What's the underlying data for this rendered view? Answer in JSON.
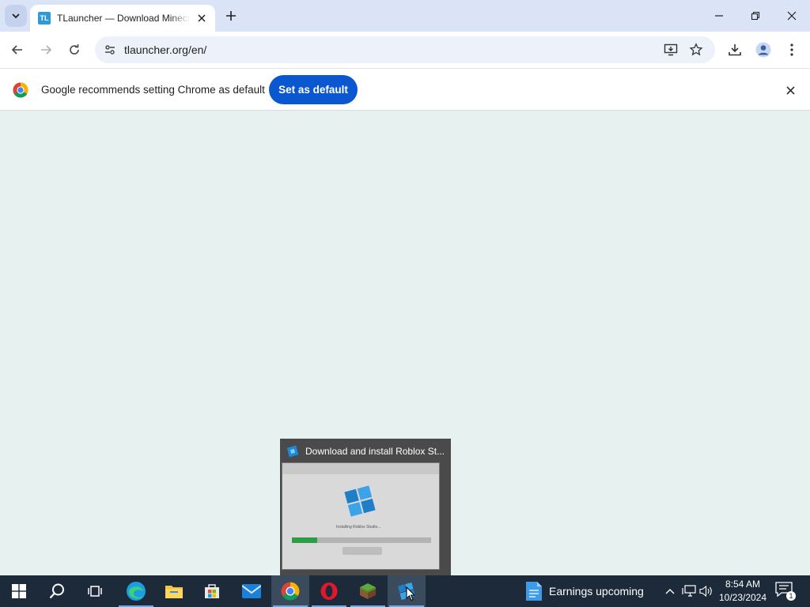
{
  "browser": {
    "tab": {
      "favicon_text": "TL",
      "title": "TLauncher — Download Minecraft"
    },
    "url": "tlauncher.org/en/",
    "infobar": {
      "message": "Google recommends setting Chrome as default",
      "button_label": "Set as default"
    }
  },
  "preview": {
    "title": "Download and install Roblox St...",
    "thumb_text": "Installing Roblox Studio...",
    "progress": 0.18
  },
  "taskbar": {
    "apps": [
      "start-button",
      "search-button",
      "task-view-button",
      "edge",
      "file-explorer",
      "microsoft-store",
      "mail",
      "chrome",
      "opera",
      "minecraft",
      "roblox-studio"
    ],
    "weather_text": "Earnings upcoming",
    "time": "8:54 AM",
    "date": "10/23/2024",
    "notification_count": "1"
  },
  "colors": {
    "accent": "#0b57d0",
    "page_bg": "#e6f1f0",
    "taskbar": "#1c2a3a"
  }
}
